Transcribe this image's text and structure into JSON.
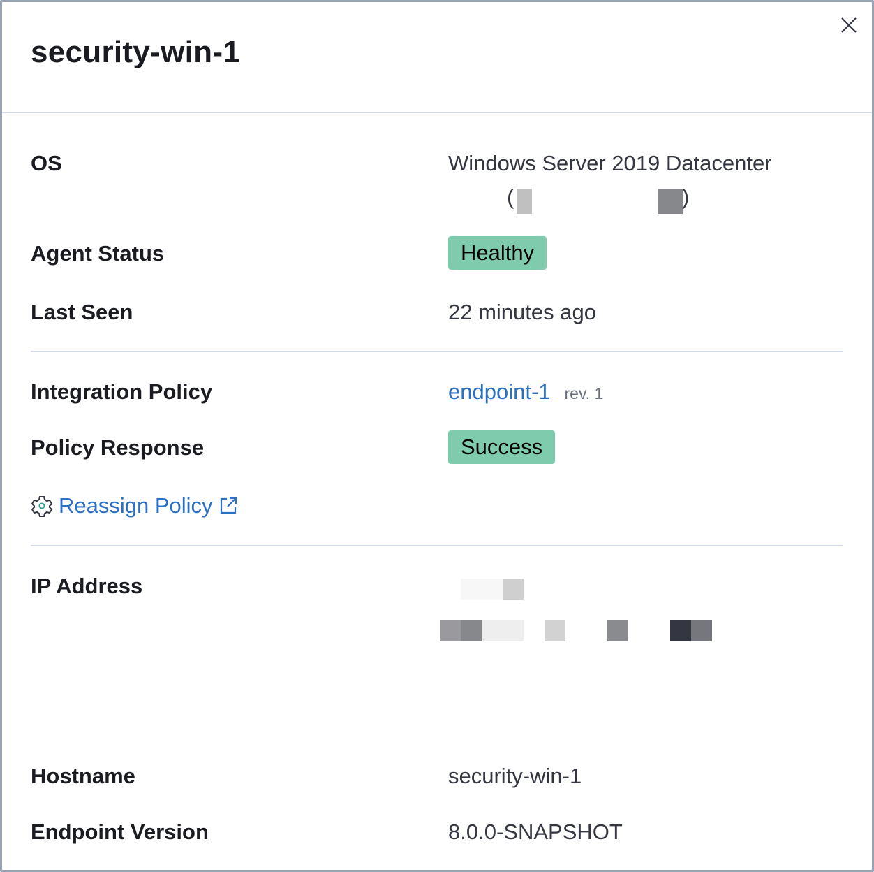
{
  "title": "security-win-1",
  "close_label": "close",
  "os": {
    "label": "OS",
    "value": "Windows Server 2019 Datacenter",
    "paren_open": "(",
    "paren_close": ")"
  },
  "agent_status": {
    "label": "Agent Status",
    "value": "Healthy"
  },
  "last_seen": {
    "label": "Last Seen",
    "value": "22 minutes ago"
  },
  "integration_policy": {
    "label": "Integration Policy",
    "value": "endpoint-1",
    "rev": "rev. 1"
  },
  "policy_response": {
    "label": "Policy Response",
    "value": "Success"
  },
  "reassign": {
    "label": "Reassign Policy"
  },
  "ip_address": {
    "label": "IP Address"
  },
  "hostname": {
    "label": "Hostname",
    "value": "security-win-1"
  },
  "endpoint_version": {
    "label": "Endpoint Version",
    "value": "8.0.0-SNAPSHOT"
  },
  "colors": {
    "badge": "#7fcbad",
    "link": "#2b70c2"
  }
}
